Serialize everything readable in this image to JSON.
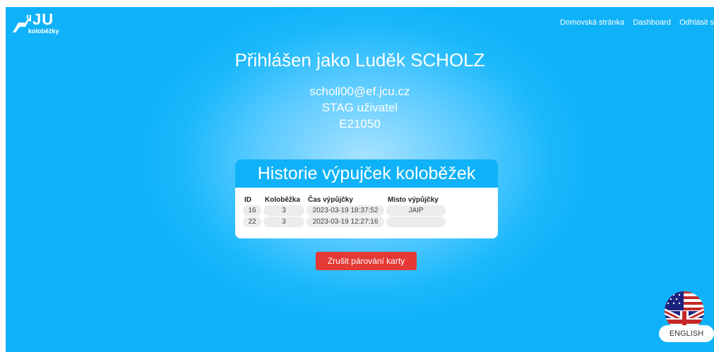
{
  "header": {
    "logo_text": "JU",
    "logo_sub": "koloběžky",
    "nav": [
      "Domovská stránka",
      "Dashboard",
      "Odhlásit s"
    ]
  },
  "profile": {
    "title": "Přihlášen jako Luděk SCHOLZ",
    "email": "scholl00@ef.jcu.cz",
    "role": "STAG uživatel",
    "code": "E21050"
  },
  "history": {
    "title": "Historie výpujček koloběžek",
    "columns": [
      "ID",
      "Koloběžka",
      "Čas výpůjčky",
      "Misto výpůjčky"
    ],
    "rows": [
      [
        "16",
        "3",
        "2023-03-19 18:37:52",
        "JAIP"
      ],
      [
        "22",
        "3",
        "2023-03-19 12:27:16",
        ""
      ]
    ]
  },
  "cancel_button": "Zrušit párování karty",
  "language_button": "ENGLISH"
}
